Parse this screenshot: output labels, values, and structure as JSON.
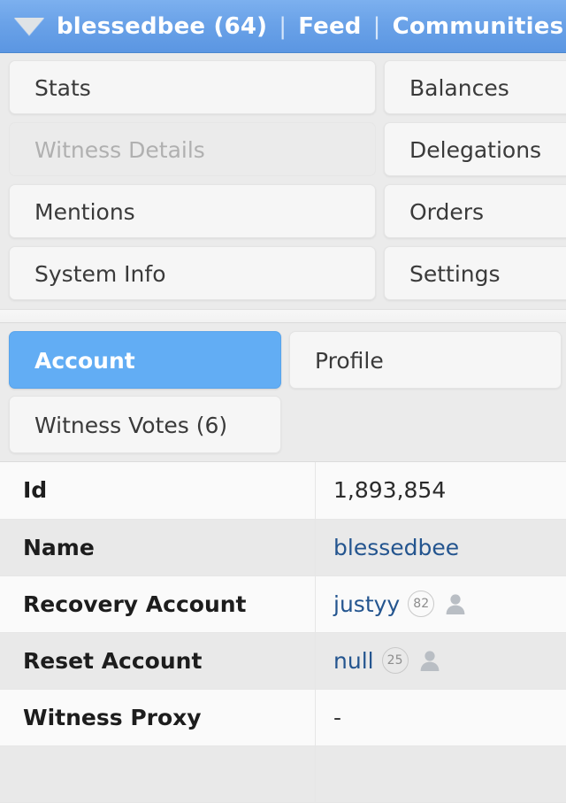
{
  "theme": {
    "header_blue": "#6aa2e8",
    "active_tab_blue": "#62adf4",
    "link_blue": "#24558f",
    "panel_gray": "#ebebeb",
    "button_gray": "#f6f6f6",
    "disabled_text": "#b0b0b0"
  },
  "header": {
    "caret_icon": "chevron-down-icon",
    "account_label": "blessedbee (64)",
    "separator": "|",
    "items": [
      {
        "label": "blessedbee (64)"
      },
      {
        "label": "Feed"
      },
      {
        "label": "Communities"
      }
    ],
    "trailing_separator": "|"
  },
  "nav_buttons": {
    "rows": [
      {
        "left": {
          "label": "Stats",
          "disabled": false
        },
        "right": {
          "label": "Balances",
          "disabled": false
        }
      },
      {
        "left": {
          "label": "Witness Details",
          "disabled": true
        },
        "right": {
          "label": "Delegations",
          "disabled": false
        }
      },
      {
        "left": {
          "label": "Mentions",
          "disabled": false
        },
        "right": {
          "label": "Orders",
          "disabled": false
        }
      },
      {
        "left": {
          "label": "System Info",
          "disabled": false
        },
        "right": {
          "label": "Settings",
          "disabled": false
        }
      }
    ]
  },
  "tabs": {
    "row1": [
      {
        "label": "Account",
        "active": true
      },
      {
        "label": "Profile",
        "active": false
      }
    ],
    "row2": [
      {
        "label": "Witness Votes (6)",
        "active": false
      }
    ]
  },
  "details": {
    "rows": [
      {
        "key": "Id",
        "value": "1,893,854",
        "is_link": false,
        "reputation": null,
        "avatar": false
      },
      {
        "key": "Name",
        "value": "blessedbee",
        "is_link": true,
        "reputation": null,
        "avatar": false
      },
      {
        "key": "Recovery Account",
        "value": "justyy",
        "is_link": true,
        "reputation": "82",
        "avatar": true
      },
      {
        "key": "Reset Account",
        "value": "null",
        "is_link": true,
        "reputation": "25",
        "avatar": true
      },
      {
        "key": "Witness Proxy",
        "value": "-",
        "is_link": false,
        "reputation": null,
        "avatar": false
      }
    ]
  }
}
